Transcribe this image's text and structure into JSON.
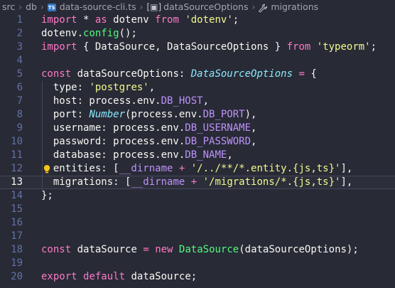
{
  "breadcrumb": {
    "items": [
      "src",
      "db",
      "data-source-cli.ts",
      "dataSourceOptions",
      "migrations"
    ],
    "file_badge": "TS"
  },
  "editor": {
    "current_line": 13,
    "lightbulb_line": 12,
    "lines": [
      {
        "n": "1",
        "tokens": [
          {
            "t": "import",
            "c": "key"
          },
          {
            "t": " * ",
            "c": "plain"
          },
          {
            "t": "as",
            "c": "key"
          },
          {
            "t": " dotenv ",
            "c": "plain"
          },
          {
            "t": "from",
            "c": "key"
          },
          {
            "t": " ",
            "c": "plain"
          },
          {
            "t": "'dotenv'",
            "c": "str"
          },
          {
            "t": ";",
            "c": "plain"
          }
        ]
      },
      {
        "n": "2",
        "tokens": [
          {
            "t": "dotenv.",
            "c": "plain"
          },
          {
            "t": "config",
            "c": "fn"
          },
          {
            "t": "();",
            "c": "plain"
          }
        ]
      },
      {
        "n": "3",
        "tokens": [
          {
            "t": "import",
            "c": "key"
          },
          {
            "t": " { DataSource, DataSourceOptions } ",
            "c": "plain"
          },
          {
            "t": "from",
            "c": "key"
          },
          {
            "t": " ",
            "c": "plain"
          },
          {
            "t": "'typeorm'",
            "c": "str"
          },
          {
            "t": ";",
            "c": "plain"
          }
        ]
      },
      {
        "n": "4",
        "tokens": []
      },
      {
        "n": "5",
        "tokens": [
          {
            "t": "const",
            "c": "key"
          },
          {
            "t": " dataSourceOptions: ",
            "c": "plain"
          },
          {
            "t": "DataSourceOptions",
            "c": "type"
          },
          {
            "t": " ",
            "c": "plain"
          },
          {
            "t": "=",
            "c": "key"
          },
          {
            "t": " {",
            "c": "plain"
          }
        ]
      },
      {
        "n": "6",
        "tokens": [
          {
            "t": "  type: ",
            "c": "plain"
          },
          {
            "t": "'postgres'",
            "c": "str"
          },
          {
            "t": ",",
            "c": "plain"
          }
        ],
        "guide": true
      },
      {
        "n": "7",
        "tokens": [
          {
            "t": "  host: process.env.",
            "c": "plain"
          },
          {
            "t": "DB_HOST",
            "c": "env"
          },
          {
            "t": ",",
            "c": "plain"
          }
        ],
        "guide": true
      },
      {
        "n": "8",
        "tokens": [
          {
            "t": "  port: ",
            "c": "plain"
          },
          {
            "t": "Number",
            "c": "type"
          },
          {
            "t": "(process.env.",
            "c": "plain"
          },
          {
            "t": "DB_PORT",
            "c": "env"
          },
          {
            "t": "),",
            "c": "plain"
          }
        ],
        "guide": true
      },
      {
        "n": "9",
        "tokens": [
          {
            "t": "  username: process.env.",
            "c": "plain"
          },
          {
            "t": "DB_USERNAME",
            "c": "env"
          },
          {
            "t": ",",
            "c": "plain"
          }
        ],
        "guide": true
      },
      {
        "n": "10",
        "tokens": [
          {
            "t": "  password: process.env.",
            "c": "plain"
          },
          {
            "t": "DB_PASSWORD",
            "c": "env"
          },
          {
            "t": ",",
            "c": "plain"
          }
        ],
        "guide": true
      },
      {
        "n": "11",
        "tokens": [
          {
            "t": "  database: process.env.",
            "c": "plain"
          },
          {
            "t": "DB_NAME",
            "c": "env"
          },
          {
            "t": ",",
            "c": "plain"
          }
        ],
        "guide": true
      },
      {
        "n": "12",
        "tokens": [
          {
            "t": "  entities: [",
            "c": "plain"
          },
          {
            "t": "__dirname",
            "c": "env"
          },
          {
            "t": " ",
            "c": "plain"
          },
          {
            "t": "+",
            "c": "key"
          },
          {
            "t": " ",
            "c": "plain"
          },
          {
            "t": "'/../**/*.entity.{js,ts}'",
            "c": "str"
          },
          {
            "t": "],",
            "c": "plain"
          }
        ],
        "guide": true
      },
      {
        "n": "13",
        "tokens": [
          {
            "t": "  migrations: [",
            "c": "plain"
          },
          {
            "t": "__dirname",
            "c": "env"
          },
          {
            "t": " ",
            "c": "plain"
          },
          {
            "t": "+",
            "c": "key"
          },
          {
            "t": " ",
            "c": "plain"
          },
          {
            "t": "'/migrations/*.{js,ts}'",
            "c": "str"
          },
          {
            "t": "],",
            "c": "plain"
          }
        ],
        "guide": true
      },
      {
        "n": "14",
        "tokens": [
          {
            "t": "};",
            "c": "plain"
          }
        ]
      },
      {
        "n": "15",
        "tokens": []
      },
      {
        "n": "16",
        "tokens": []
      },
      {
        "n": "17",
        "tokens": []
      },
      {
        "n": "18",
        "tokens": [
          {
            "t": "const",
            "c": "key"
          },
          {
            "t": " dataSource ",
            "c": "plain"
          },
          {
            "t": "=",
            "c": "key"
          },
          {
            "t": " ",
            "c": "plain"
          },
          {
            "t": "new",
            "c": "key"
          },
          {
            "t": " ",
            "c": "plain"
          },
          {
            "t": "DataSource",
            "c": "fn"
          },
          {
            "t": "(dataSourceOptions);",
            "c": "plain"
          }
        ]
      },
      {
        "n": "19",
        "tokens": []
      },
      {
        "n": "20",
        "tokens": [
          {
            "t": "export",
            "c": "key"
          },
          {
            "t": " ",
            "c": "plain"
          },
          {
            "t": "default",
            "c": "key"
          },
          {
            "t": " dataSource;",
            "c": "plain"
          }
        ]
      }
    ]
  },
  "colors": {
    "background": "#282a36",
    "keyword": "#ff79c6",
    "string": "#f1fa8c",
    "function": "#50fa7b",
    "type": "#8be9fd",
    "constant": "#bd93f9",
    "line_number": "#6272a4"
  },
  "icons": {
    "file": "typescript-file-icon",
    "symbol": "symbol-braces-icon",
    "property": "wrench-icon",
    "hint": "lightbulb-icon"
  }
}
